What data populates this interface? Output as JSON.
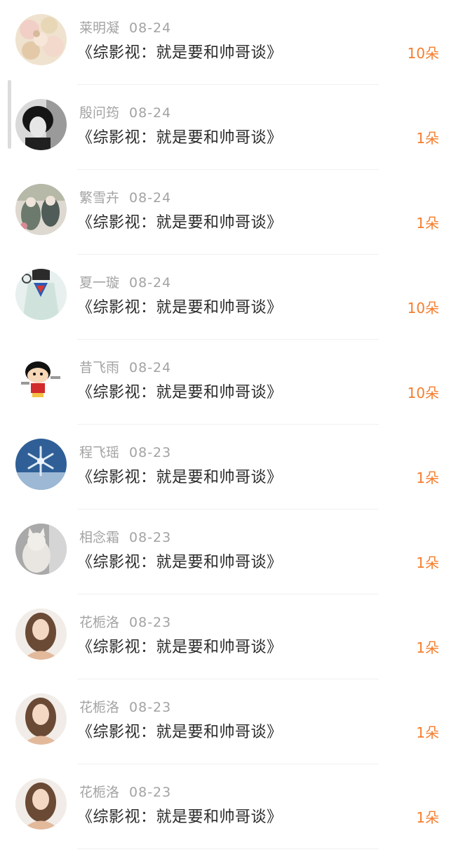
{
  "colors": {
    "name": "#a3a3a3",
    "title": "#2b2b2b",
    "amount": "#f57d2c",
    "divider": "#f0f0f0"
  },
  "entries": [
    {
      "name": "莱明凝",
      "date": "08-24",
      "title": "《综影视：就是要和帅哥谈》",
      "amount": "10朵",
      "avatar": "flowers-avatar"
    },
    {
      "name": "殷问筠",
      "date": "08-24",
      "title": "《综影视：就是要和帅哥谈》",
      "amount": "1朵",
      "avatar": "bw-portrait-avatar"
    },
    {
      "name": "繁雪卉",
      "date": "08-24",
      "title": "《综影视：就是要和帅哥谈》",
      "amount": "1朵",
      "avatar": "illustration-avatar"
    },
    {
      "name": "夏一璇",
      "date": "08-24",
      "title": "《综影视：就是要和帅哥谈》",
      "amount": "10朵",
      "avatar": "superman-shirt-avatar"
    },
    {
      "name": "昔飞雨",
      "date": "08-24",
      "title": "《综影视：就是要和帅哥谈》",
      "amount": "10朵",
      "avatar": "cartoon-boy-avatar"
    },
    {
      "name": "程飞瑶",
      "date": "08-23",
      "title": "《综影视：就是要和帅哥谈》",
      "amount": "1朵",
      "avatar": "snowflake-avatar"
    },
    {
      "name": "相念霜",
      "date": "08-23",
      "title": "《综影视：就是要和帅哥谈》",
      "amount": "1朵",
      "avatar": "cat-avatar"
    },
    {
      "name": "花栀洛",
      "date": "08-23",
      "title": "《综影视：就是要和帅哥谈》",
      "amount": "1朵",
      "avatar": "girl-portrait-avatar"
    },
    {
      "name": "花栀洛",
      "date": "08-23",
      "title": "《综影视：就是要和帅哥谈》",
      "amount": "1朵",
      "avatar": "girl-portrait-avatar"
    },
    {
      "name": "花栀洛",
      "date": "08-23",
      "title": "《综影视：就是要和帅哥谈》",
      "amount": "1朵",
      "avatar": "girl-portrait-avatar"
    }
  ]
}
